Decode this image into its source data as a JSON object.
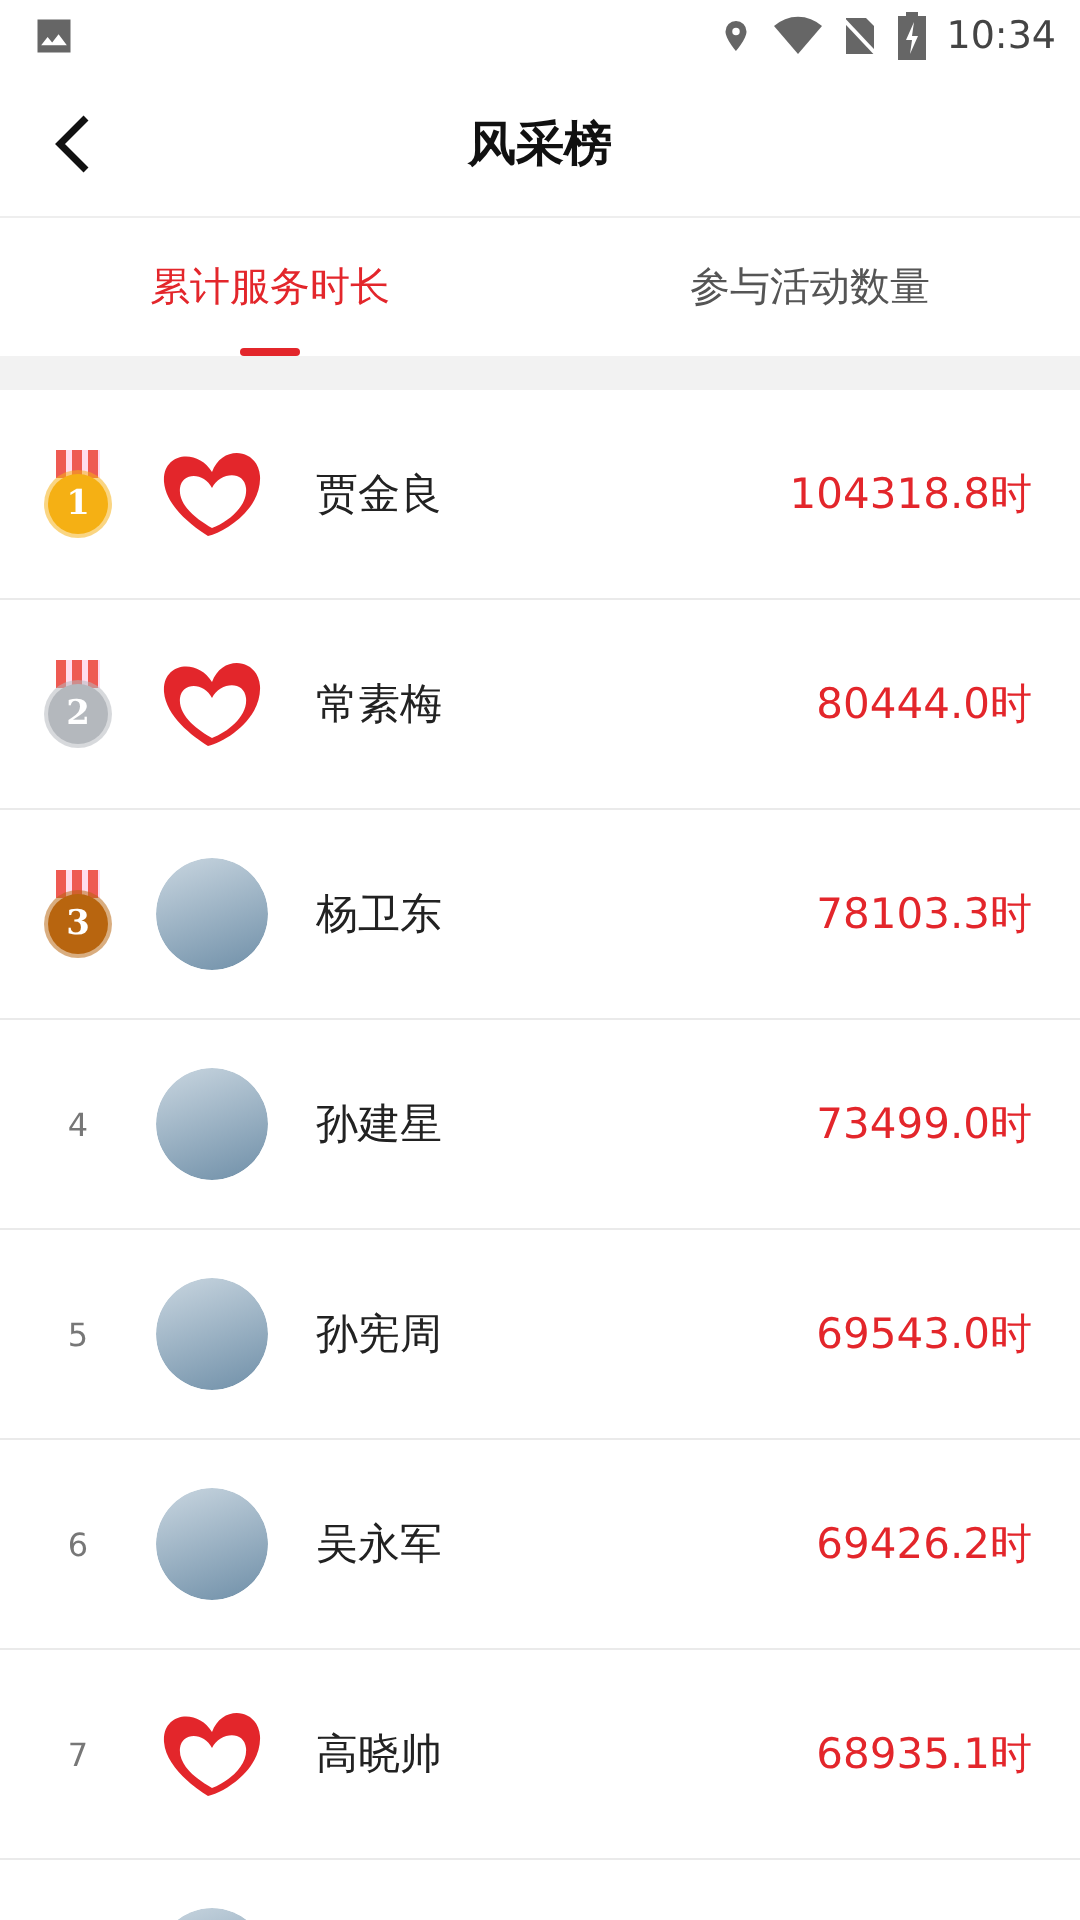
{
  "status_bar": {
    "time": "10:34"
  },
  "header": {
    "title": "风采榜"
  },
  "tabs": [
    {
      "label": "累计服务时长",
      "selected": true
    },
    {
      "label": "参与活动数量",
      "selected": false
    }
  ],
  "rows": [
    {
      "rank": "1",
      "kind": "medal",
      "color": "#f5b014",
      "avatar": {
        "kind": "logo"
      },
      "name": "贾金良",
      "value": "104318.8时"
    },
    {
      "rank": "2",
      "kind": "medal",
      "color": "#b4b8bd",
      "avatar": {
        "kind": "logo"
      },
      "name": "常素梅",
      "value": "80444.0时"
    },
    {
      "rank": "3",
      "kind": "medal",
      "color": "#b8650f",
      "avatar": {
        "kind": "photo"
      },
      "name": "杨卫东",
      "value": "78103.3时"
    },
    {
      "rank": "4",
      "kind": "plain",
      "avatar": {
        "kind": "photo"
      },
      "name": "孙建星",
      "value": "73499.0时"
    },
    {
      "rank": "5",
      "kind": "plain",
      "avatar": {
        "kind": "photo"
      },
      "name": "孙宪周",
      "value": "69543.0时"
    },
    {
      "rank": "6",
      "kind": "plain",
      "avatar": {
        "kind": "photo"
      },
      "name": "吴永军",
      "value": "69426.2时"
    },
    {
      "rank": "7",
      "kind": "plain",
      "avatar": {
        "kind": "logo"
      },
      "name": "高晓帅",
      "value": "68935.1时"
    },
    {
      "avatar": {
        "kind": "photo"
      }
    }
  ]
}
